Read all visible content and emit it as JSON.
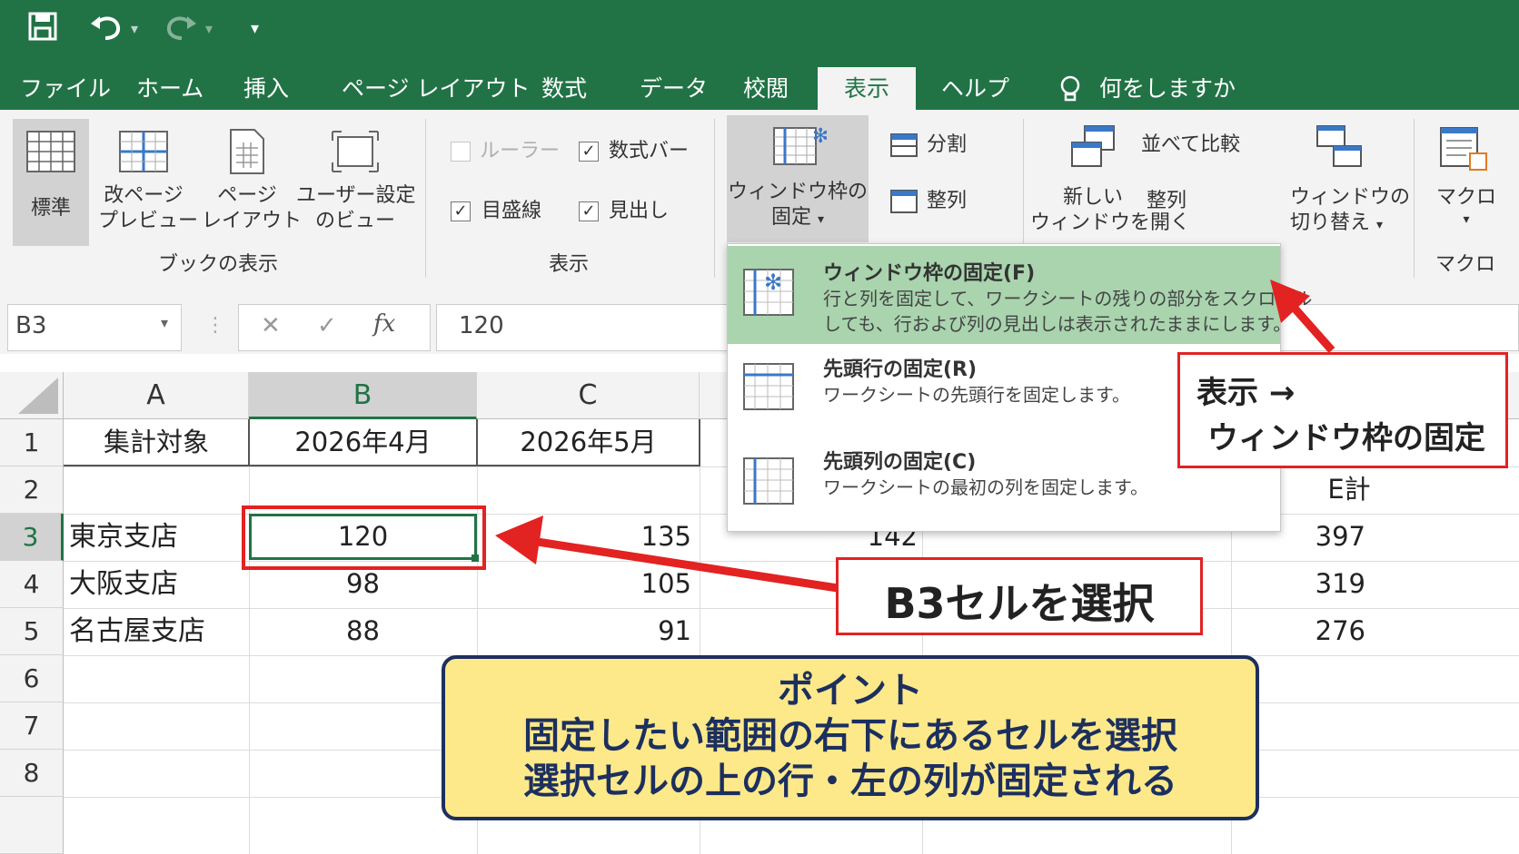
{
  "qat": {
    "save_icon": "save-icon",
    "undo_icon": "undo-icon",
    "redo_icon": "redo-icon",
    "customize_icon": "customize-qat-icon"
  },
  "tabs": [
    {
      "label": "ファイル"
    },
    {
      "label": "ホーム"
    },
    {
      "label": "挿入"
    },
    {
      "label": "ページ レイアウト"
    },
    {
      "label": "数式"
    },
    {
      "label": "データ"
    },
    {
      "label": "校閲"
    },
    {
      "label": "表示"
    },
    {
      "label": "ヘルプ"
    }
  ],
  "tell_me": "何をしますか",
  "ribbon": {
    "normal": "標準",
    "page_break_1": "改ページ",
    "page_break_2": "プレビュー",
    "page_layout_1": "ページ",
    "page_layout_2": "レイアウト",
    "custom_view_1": "ユーザー設定",
    "custom_view_2": "のビュー",
    "group_book_view": "ブックの表示",
    "ruler": "ルーラー",
    "formula_bar": "数式バー",
    "gridlines": "目盛線",
    "headings": "見出し",
    "group_show": "表示",
    "freeze_1": "ウィンドウ枠の",
    "freeze_2": "固定",
    "split": "分割",
    "arrange": "整列",
    "new_window_1": "新しい",
    "new_window_2": "ウィンドウを開く",
    "side_by_side": "並べて比較",
    "arrange_all": "整列",
    "switch_1": "ウィンドウの",
    "switch_2": "切り替え",
    "macro": "マクロ",
    "group_macro": "マクロ"
  },
  "formula_bar": {
    "name_box": "B3",
    "cancel": "✕",
    "enter": "✓",
    "fx": "fx",
    "value": "120"
  },
  "columns": [
    "A",
    "B",
    "C"
  ],
  "rows": [
    "1",
    "2",
    "3",
    "4",
    "5",
    "6",
    "7",
    "8"
  ],
  "cells": {
    "a1": "集計対象",
    "b1": "2026年4月",
    "c1": "2026年5月",
    "a3": "東京支店",
    "b3": "120",
    "c3": "135",
    "d3": "142",
    "f3": "397",
    "a4": "大阪支店",
    "b4": "98",
    "c4": "105",
    "f4": "319",
    "a5": "名古屋支店",
    "b5": "88",
    "c5": "91",
    "f5": "276",
    "f2": "E計"
  },
  "dropdown": {
    "item1_title": "ウィンドウ枠の固定(F)",
    "item1_desc1": "行と列を固定して、ワークシートの残りの部分をスクロール",
    "item1_desc2": "しても、行および列の見出しは表示されたままにします。",
    "item2_title": "先頭行の固定(R)",
    "item2_desc": "ワークシートの先頭行を固定します。",
    "item3_title": "先頭列の固定(C)",
    "item3_desc": "ワークシートの最初の列を固定します。"
  },
  "callouts": {
    "view_1": "表示 →",
    "view_2": "ウィンドウ枠の固定",
    "select_b3": "B3セルを選択",
    "point_1": "ポイント",
    "point_2": "固定したい範囲の右下にあるセルを選択",
    "point_3": "選択セルの上の行・左の列が固定される"
  },
  "colors": {
    "excel_green": "#217346",
    "callout_red": "#e32222",
    "point_bg": "#fde98a",
    "point_border": "#1c2f5e",
    "highlight": "#a9d4ae"
  }
}
